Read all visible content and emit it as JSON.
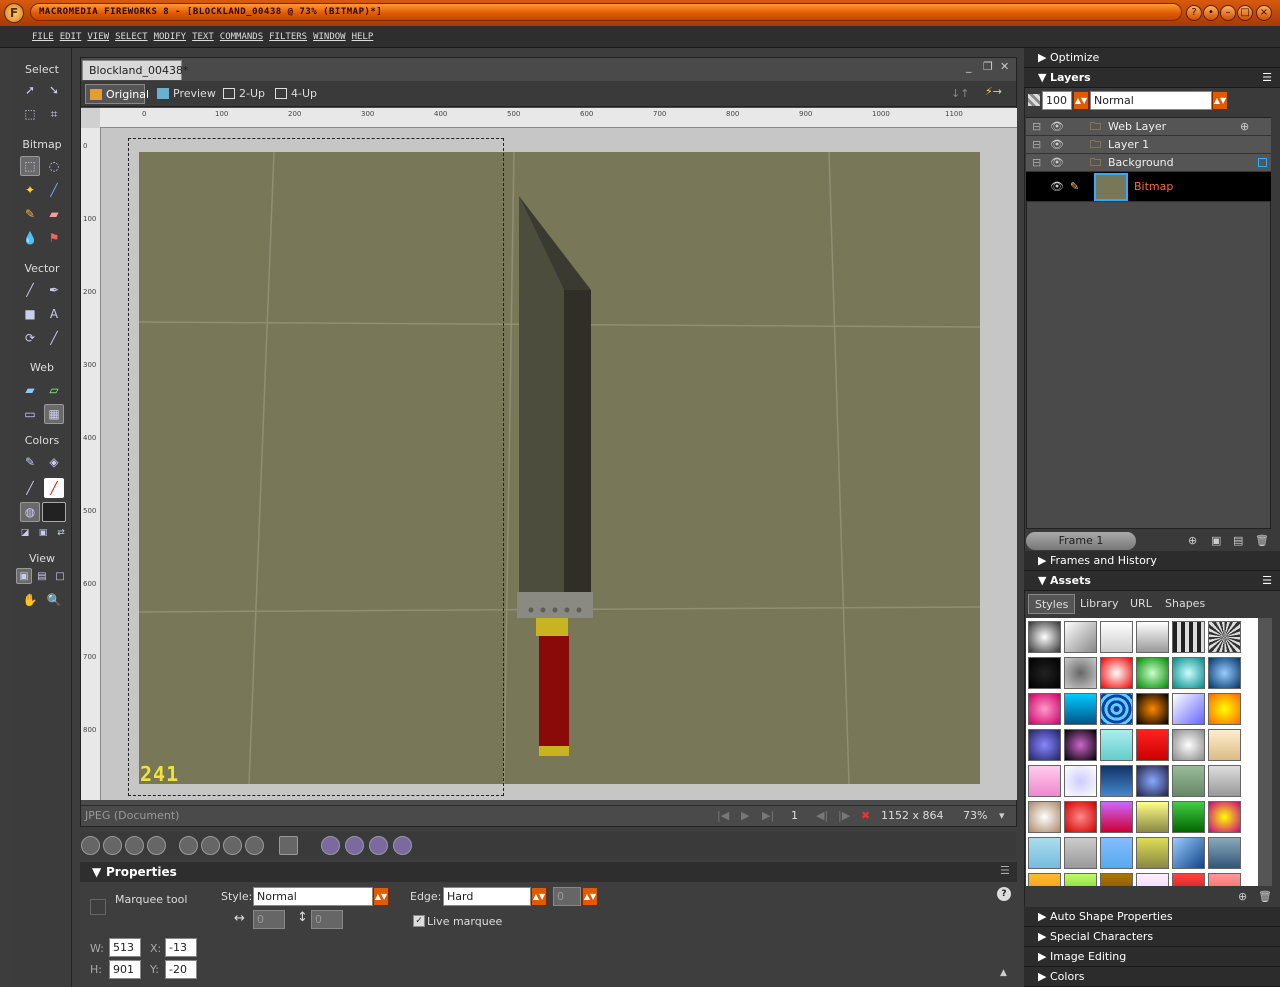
{
  "window": {
    "title": "MACROMEDIA FIREWORKS 8 - [BLOCKLAND_00438 @ 73% (BITMAP)*]"
  },
  "menu": [
    "FILE",
    "EDIT",
    "VIEW",
    "SELECT",
    "MODIFY",
    "TEXT",
    "COMMANDS",
    "FILTERS",
    "WINDOW",
    "HELP"
  ],
  "toolbox": {
    "select": "Select",
    "bitmap": "Bitmap",
    "vector": "Vector",
    "web": "Web",
    "colors": "Colors",
    "view": "View"
  },
  "document": {
    "tab": "Blockland_00438*",
    "views": [
      "Original",
      "Preview",
      "2-Up",
      "4-Up"
    ],
    "ruler_top": [
      "0",
      "100",
      "200",
      "300",
      "400",
      "500",
      "600",
      "700",
      "800",
      "900",
      "1000",
      "1100"
    ],
    "ruler_left": [
      "0",
      "100",
      "200",
      "300",
      "400",
      "500",
      "600",
      "700",
      "800"
    ],
    "overlay_counter": "241",
    "status_type": "JPEG (Document)",
    "frame": "1",
    "size": "1152 x 864",
    "zoom": "73%"
  },
  "properties": {
    "title": "Properties",
    "tool": "Marquee tool",
    "style_label": "Style:",
    "style_value": "Normal",
    "edge_label": "Edge:",
    "edge_value": "Hard",
    "edge_amount": "0",
    "fixed_w": "0",
    "fixed_h": "0",
    "live_marquee": "Live marquee",
    "w_label": "W:",
    "w_value": "513",
    "h_label": "H:",
    "h_value": "901",
    "x_label": "X:",
    "x_value": "-13",
    "y_label": "Y:",
    "y_value": "-20"
  },
  "panels": {
    "optimize": "Optimize",
    "layers": "Layers",
    "opacity": "100",
    "blend": "Normal",
    "layer_rows": [
      "Web Layer",
      "Layer 1",
      "Background",
      "Bitmap"
    ],
    "frame": "Frame 1",
    "frames_history": "Frames and History",
    "assets": "Assets",
    "asset_tabs": [
      "Styles",
      "Library",
      "URL",
      "Shapes"
    ],
    "auto_shape": "Auto Shape Properties",
    "special_chars": "Special Characters",
    "image_editing": "Image Editing",
    "colors": "Colors"
  },
  "colors": {
    "accent": "#e05a00",
    "canvas": "#787859",
    "selected_layer": "#000000"
  }
}
